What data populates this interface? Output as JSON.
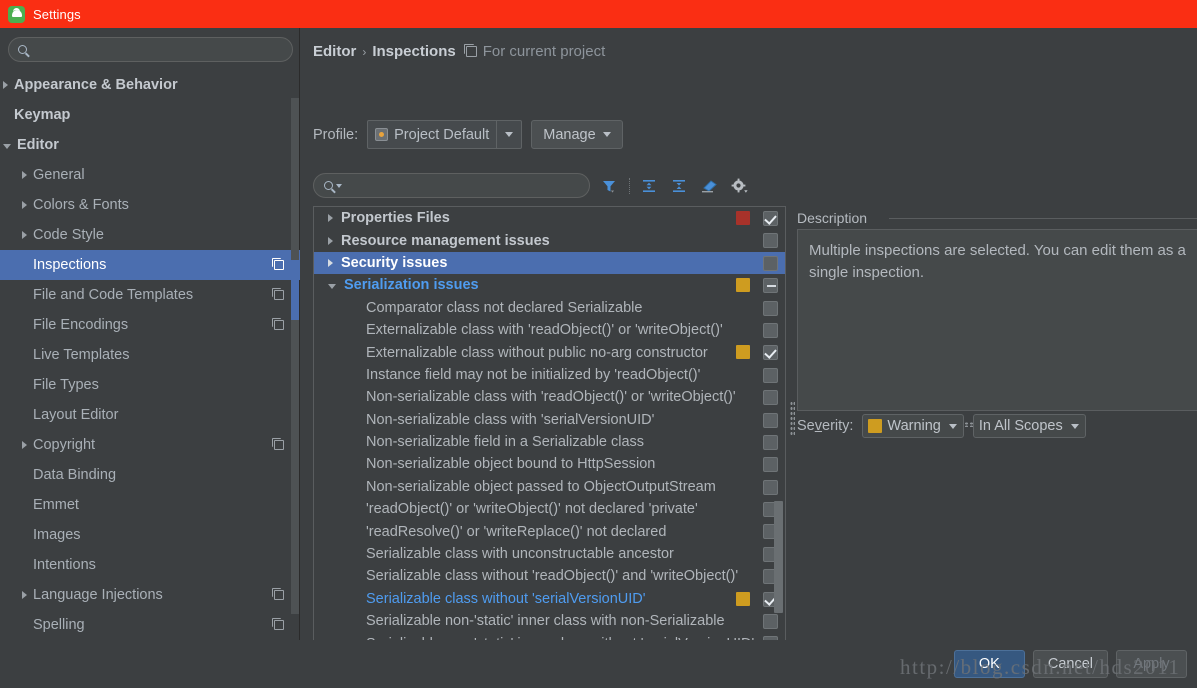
{
  "window": {
    "title": "Settings",
    "icon": "android-studio-icon"
  },
  "sidebar": {
    "search_placeholder": "",
    "search_value": "",
    "items": [
      {
        "label": "Appearance & Behavior",
        "level": 0,
        "arrow": "right",
        "bold": true,
        "badge": false,
        "selected": false
      },
      {
        "label": "Keymap",
        "level": 0,
        "arrow": "none",
        "bold": true,
        "badge": false,
        "selected": false
      },
      {
        "label": "Editor",
        "level": 0,
        "arrow": "down",
        "bold": true,
        "badge": false,
        "selected": false
      },
      {
        "label": "General",
        "level": 1,
        "arrow": "right",
        "bold": false,
        "badge": false,
        "selected": false
      },
      {
        "label": "Colors & Fonts",
        "level": 1,
        "arrow": "right",
        "bold": false,
        "badge": false,
        "selected": false
      },
      {
        "label": "Code Style",
        "level": 1,
        "arrow": "right",
        "bold": false,
        "badge": false,
        "selected": false
      },
      {
        "label": "Inspections",
        "level": 1,
        "arrow": "none",
        "bold": false,
        "badge": true,
        "selected": true
      },
      {
        "label": "File and Code Templates",
        "level": 1,
        "arrow": "none",
        "bold": false,
        "badge": true,
        "selected": false
      },
      {
        "label": "File Encodings",
        "level": 1,
        "arrow": "none",
        "bold": false,
        "badge": true,
        "selected": false
      },
      {
        "label": "Live Templates",
        "level": 1,
        "arrow": "none",
        "bold": false,
        "badge": false,
        "selected": false
      },
      {
        "label": "File Types",
        "level": 1,
        "arrow": "none",
        "bold": false,
        "badge": false,
        "selected": false
      },
      {
        "label": "Layout Editor",
        "level": 1,
        "arrow": "none",
        "bold": false,
        "badge": false,
        "selected": false
      },
      {
        "label": "Copyright",
        "level": 1,
        "arrow": "right",
        "bold": false,
        "badge": true,
        "selected": false
      },
      {
        "label": "Data Binding",
        "level": 1,
        "arrow": "none",
        "bold": false,
        "badge": false,
        "selected": false
      },
      {
        "label": "Emmet",
        "level": 1,
        "arrow": "none",
        "bold": false,
        "badge": false,
        "selected": false
      },
      {
        "label": "Images",
        "level": 1,
        "arrow": "none",
        "bold": false,
        "badge": false,
        "selected": false
      },
      {
        "label": "Intentions",
        "level": 1,
        "arrow": "none",
        "bold": false,
        "badge": false,
        "selected": false
      },
      {
        "label": "Language Injections",
        "level": 1,
        "arrow": "right",
        "bold": false,
        "badge": true,
        "selected": false
      },
      {
        "label": "Spelling",
        "level": 1,
        "arrow": "none",
        "bold": false,
        "badge": true,
        "selected": false
      }
    ]
  },
  "breadcrumb": {
    "root": "Editor",
    "separator": "›",
    "leaf": "Inspections",
    "scope": "For current project"
  },
  "profile": {
    "label": "Profile:",
    "value": "Project Default",
    "manage_label": "Manage"
  },
  "toolbar": {
    "search_value": "",
    "search_placeholder": "",
    "icons": [
      "filter-icon",
      "expand-all-icon",
      "collapse-all-icon",
      "reset-icon",
      "gear-icon"
    ]
  },
  "colors": {
    "error": "#a8322a",
    "warning": "#ce9c20",
    "accent": "#4b6eaf",
    "link": "#4f9cf0",
    "titlebar": "#fa2e13"
  },
  "inspection_tree": [
    {
      "label": "Properties Files",
      "type": "group",
      "expanded": false,
      "severity": "#a8322a",
      "check": "checked",
      "selected": false,
      "blue": false
    },
    {
      "label": "Resource management issues",
      "type": "group",
      "expanded": false,
      "severity": null,
      "check": "unchecked",
      "selected": false,
      "blue": false
    },
    {
      "label": "Security issues",
      "type": "group",
      "expanded": false,
      "severity": null,
      "check": "unchecked",
      "selected": true,
      "blue": false
    },
    {
      "label": "Serialization issues",
      "type": "group",
      "expanded": true,
      "severity": "#ce9c20",
      "check": "indeterminate",
      "selected": false,
      "blue": true
    },
    {
      "label": "Comparator class not declared Serializable",
      "type": "leaf",
      "severity": null,
      "check": "unchecked",
      "selected": false,
      "blue": false
    },
    {
      "label": "Externalizable class with 'readObject()' or 'writeObject()'",
      "type": "leaf",
      "severity": null,
      "check": "unchecked",
      "selected": false,
      "blue": false
    },
    {
      "label": "Externalizable class without public no-arg constructor",
      "type": "leaf",
      "severity": "#ce9c20",
      "check": "checked",
      "selected": false,
      "blue": false
    },
    {
      "label": "Instance field may not be initialized by 'readObject()'",
      "type": "leaf",
      "severity": null,
      "check": "unchecked",
      "selected": false,
      "blue": false
    },
    {
      "label": "Non-serializable class with 'readObject()' or 'writeObject()'",
      "type": "leaf",
      "severity": null,
      "check": "unchecked",
      "selected": false,
      "blue": false
    },
    {
      "label": "Non-serializable class with 'serialVersionUID'",
      "type": "leaf",
      "severity": null,
      "check": "unchecked",
      "selected": false,
      "blue": false
    },
    {
      "label": "Non-serializable field in a Serializable class",
      "type": "leaf",
      "severity": null,
      "check": "unchecked",
      "selected": false,
      "blue": false
    },
    {
      "label": "Non-serializable object bound to HttpSession",
      "type": "leaf",
      "severity": null,
      "check": "unchecked",
      "selected": false,
      "blue": false
    },
    {
      "label": "Non-serializable object passed to ObjectOutputStream",
      "type": "leaf",
      "severity": null,
      "check": "unchecked",
      "selected": false,
      "blue": false
    },
    {
      "label": "'readObject()' or 'writeObject()' not declared 'private'",
      "type": "leaf",
      "severity": null,
      "check": "unchecked",
      "selected": false,
      "blue": false
    },
    {
      "label": "'readResolve()' or 'writeReplace()' not declared",
      "type": "leaf",
      "severity": null,
      "check": "unchecked",
      "selected": false,
      "blue": false
    },
    {
      "label": "Serializable class with unconstructable ancestor",
      "type": "leaf",
      "severity": null,
      "check": "unchecked",
      "selected": false,
      "blue": false
    },
    {
      "label": "Serializable class without 'readObject()' and 'writeObject()'",
      "type": "leaf",
      "severity": null,
      "check": "unchecked",
      "selected": false,
      "blue": false
    },
    {
      "label": "Serializable class without 'serialVersionUID'",
      "type": "leaf",
      "severity": "#ce9c20",
      "check": "checked",
      "selected": false,
      "blue": true
    },
    {
      "label": "Serializable non-'static' inner class with non-Serializable",
      "type": "leaf",
      "severity": null,
      "check": "unchecked",
      "selected": false,
      "blue": false
    },
    {
      "label": "Serializable non-'static' inner class without 'serialVersionUID'",
      "type": "leaf",
      "severity": null,
      "check": "unchecked",
      "selected": false,
      "blue": false
    }
  ],
  "description": {
    "legend": "Description",
    "text": "Multiple inspections are selected. You can edit them as a\nsingle inspection."
  },
  "severity": {
    "label_pre": "Se",
    "label_mnemonic": "v",
    "label_post": "erity:",
    "value": "Warning",
    "scope": "In All Scopes"
  },
  "footer": {
    "ok": "OK",
    "cancel": "Cancel",
    "apply": "Apply",
    "watermark": "http://blog.csdn.net/hds2011"
  }
}
